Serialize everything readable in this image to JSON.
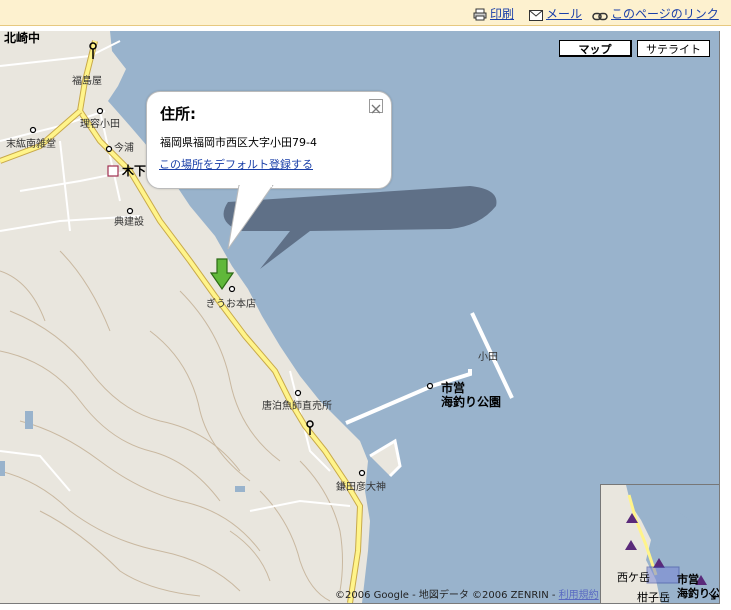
{
  "toolbar": {
    "print_label": "印刷",
    "mail_label": "メール",
    "link_label": "このページのリンク"
  },
  "map_type": {
    "map_label": "マップ",
    "satellite_label": "サテライト"
  },
  "info_window": {
    "title": "住所:",
    "address": "福岡県福岡市西区大字小田79-4",
    "default_link": "この場所をデフォルト登録する"
  },
  "places": {
    "kitazaki_school": "北崎中",
    "fukushima": "福島屋",
    "rigyo": "理容小田",
    "sueto": "末紘南雑堂",
    "kandou": "今浦",
    "kinoshita": "木下",
    "kensetsu": "典建設",
    "giou_honten": "ぎうお本店",
    "karatomari": "唐泊魚師直売所",
    "koda": "小田",
    "shiei_park_line1": "市営",
    "shiei_park_line2": "海釣り公園",
    "kamaed_shrine": "鎌田彦大神"
  },
  "overview": {
    "nishiura": "西ケ岳",
    "shiei_line1": "市営",
    "shiei_line2": "海釣り公",
    "kaneko": "柑子岳"
  },
  "copyright": {
    "text": "©2006 Google - 地図データ ©2006 ZENRIN - ",
    "terms": "利用規約"
  },
  "colors": {
    "sea": "#99b3cc",
    "land": "#e9e6de",
    "main_road": "#fff48a",
    "marker": "#60b83a",
    "link": "#1a3fa8",
    "topbar": "#fdf1cf"
  }
}
